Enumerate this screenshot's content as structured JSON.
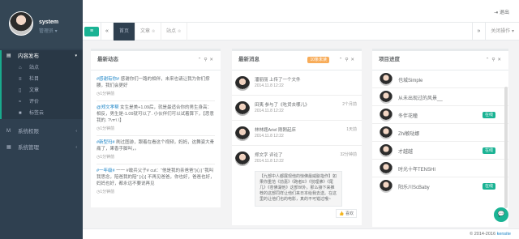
{
  "sidebar": {
    "username": "system",
    "role": "管理员",
    "items": [
      {
        "label": "内容发布"
      },
      {
        "label": "系统权限"
      },
      {
        "label": "系统管理"
      }
    ],
    "subitems": [
      {
        "label": "站点"
      },
      {
        "label": "栏目"
      },
      {
        "label": "文章"
      },
      {
        "label": "评价"
      },
      {
        "label": "标签云"
      }
    ]
  },
  "topbar": {
    "logout_label": "退出"
  },
  "tabs": {
    "items": [
      {
        "label": "首页"
      },
      {
        "label": "文章"
      },
      {
        "label": "站点"
      }
    ],
    "close_ops_label": "关闭操作"
  },
  "feed": {
    "title": "最新动态",
    "items": [
      {
        "link": "#感谢有你#",
        "text": "感谢你们一路的相伴，未来也请让我为你们撑腰，我们会更好",
        "time": "1分钟前"
      },
      {
        "link": "@郑文孝帮",
        "text": "女生是美+1.09后，就是最适合你的男生身高：相反，男生是-1.09就可以了. 小伙伴们可以试着算下，【恶意我的. ?\\ㅠ\\ \\】",
        "time": "1分钟前"
      },
      {
        "link": "#新型玛#",
        "text": "刷过图游，跟着在看这个视频，妈妈，这舞姿大骨痛了，果香手脚叫，。",
        "time": "1分钟前"
      },
      {
        "link": "#一年级#",
        "text": "一一 #敢兵父子# cut：“他是我的亲爸爸”[心] “我叫我思念，陪爸我的陪” [心] 不再见爸爸，你也好，爸爸也好，妈妈也好，都永远不要说再见",
        "time": "1分钟前"
      }
    ]
  },
  "messages": {
    "title": "最新消息",
    "badge": "10条未读",
    "items": [
      {
        "name": "潘丽丽",
        "action": "上传了一个文件",
        "time": "2014.11.8 12:22",
        "right": ""
      },
      {
        "name": "田夷",
        "action": "参与了《吃货去哪儿》",
        "time": "2014.11.8 12:22",
        "right": "2个月前"
      },
      {
        "name": "林林题Ariel",
        "action": "刚刚起床",
        "time": "2014.11.8 12:22",
        "right": "1天前"
      },
      {
        "name": "郑文字",
        "action": "评论了",
        "time": "2014.11.8 12:22",
        "right": "32分钟前"
      }
    ],
    "quote": "【九部中人都展现他的惊佛最威胁指作】如果你重范《前嘉》《跑者E》《悦理佛》《尾几》《苍佛湖他》这部世外，那么接下来推荐的这部同样让他们来日本给我去送。在这里的让他们也的电影，真的不可错过哦~",
    "like_label": "喜欢"
  },
  "projects": {
    "title": "项目进度",
    "online_label": "在线",
    "items": [
      {
        "name": "也城Simple",
        "online": false
      },
      {
        "name": "从未出现过的风景__",
        "online": false
      },
      {
        "name": "冬伴花瞳",
        "online": true
      },
      {
        "name": "Zhi敏哒娜",
        "online": false
      },
      {
        "name": "才越越",
        "online": true
      },
      {
        "name": "时光十年TENSHI",
        "online": false
      },
      {
        "name": "阳乐川ScBaby",
        "online": true
      }
    ]
  },
  "footer": {
    "copyright": "© 2014-2016",
    "brand": "kensite"
  }
}
